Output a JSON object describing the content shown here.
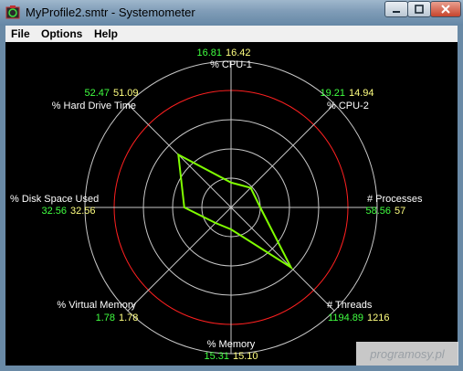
{
  "window": {
    "title": "MyProfile2.smtr - Systemometer"
  },
  "menu": {
    "items": [
      "File",
      "Options",
      "Help"
    ]
  },
  "radar": {
    "rings": 5,
    "highlight_ring_index": 4,
    "colors": {
      "background": "#000000",
      "grid": "#c8c8c8",
      "highlight_ring": "#ff2020",
      "polygon": "#80ff00",
      "label": "#ffffff",
      "value_primary": "#40ff40",
      "value_secondary": "#ffff80"
    },
    "axes": [
      {
        "label": "% CPU-1",
        "value_a": "16.81",
        "value_b": "16.42",
        "level": 0.17
      },
      {
        "label": "% CPU-2",
        "value_a": "19.21",
        "value_b": "14.94",
        "level": 0.19
      },
      {
        "label": "# Processes",
        "value_a": "58.56",
        "value_b": "57",
        "level": 0.2
      },
      {
        "label": "# Threads",
        "value_a": "1194.89",
        "value_b": "1216",
        "level": 0.58
      },
      {
        "label": "% Memory",
        "value_a": "15.31",
        "value_b": "15.10",
        "level": 0.15
      },
      {
        "label": "% Virtual Memory",
        "value_a": "1.78",
        "value_b": "1.78",
        "level": 0.15
      },
      {
        "label": "% Disk Space Used",
        "value_a": "32.56",
        "value_b": "32.56",
        "level": 0.32
      },
      {
        "label": "% Hard Drive Time",
        "value_a": "52.47",
        "value_b": "51.09",
        "level": 0.51
      }
    ]
  },
  "watermark": {
    "text": "programosy.pl"
  }
}
